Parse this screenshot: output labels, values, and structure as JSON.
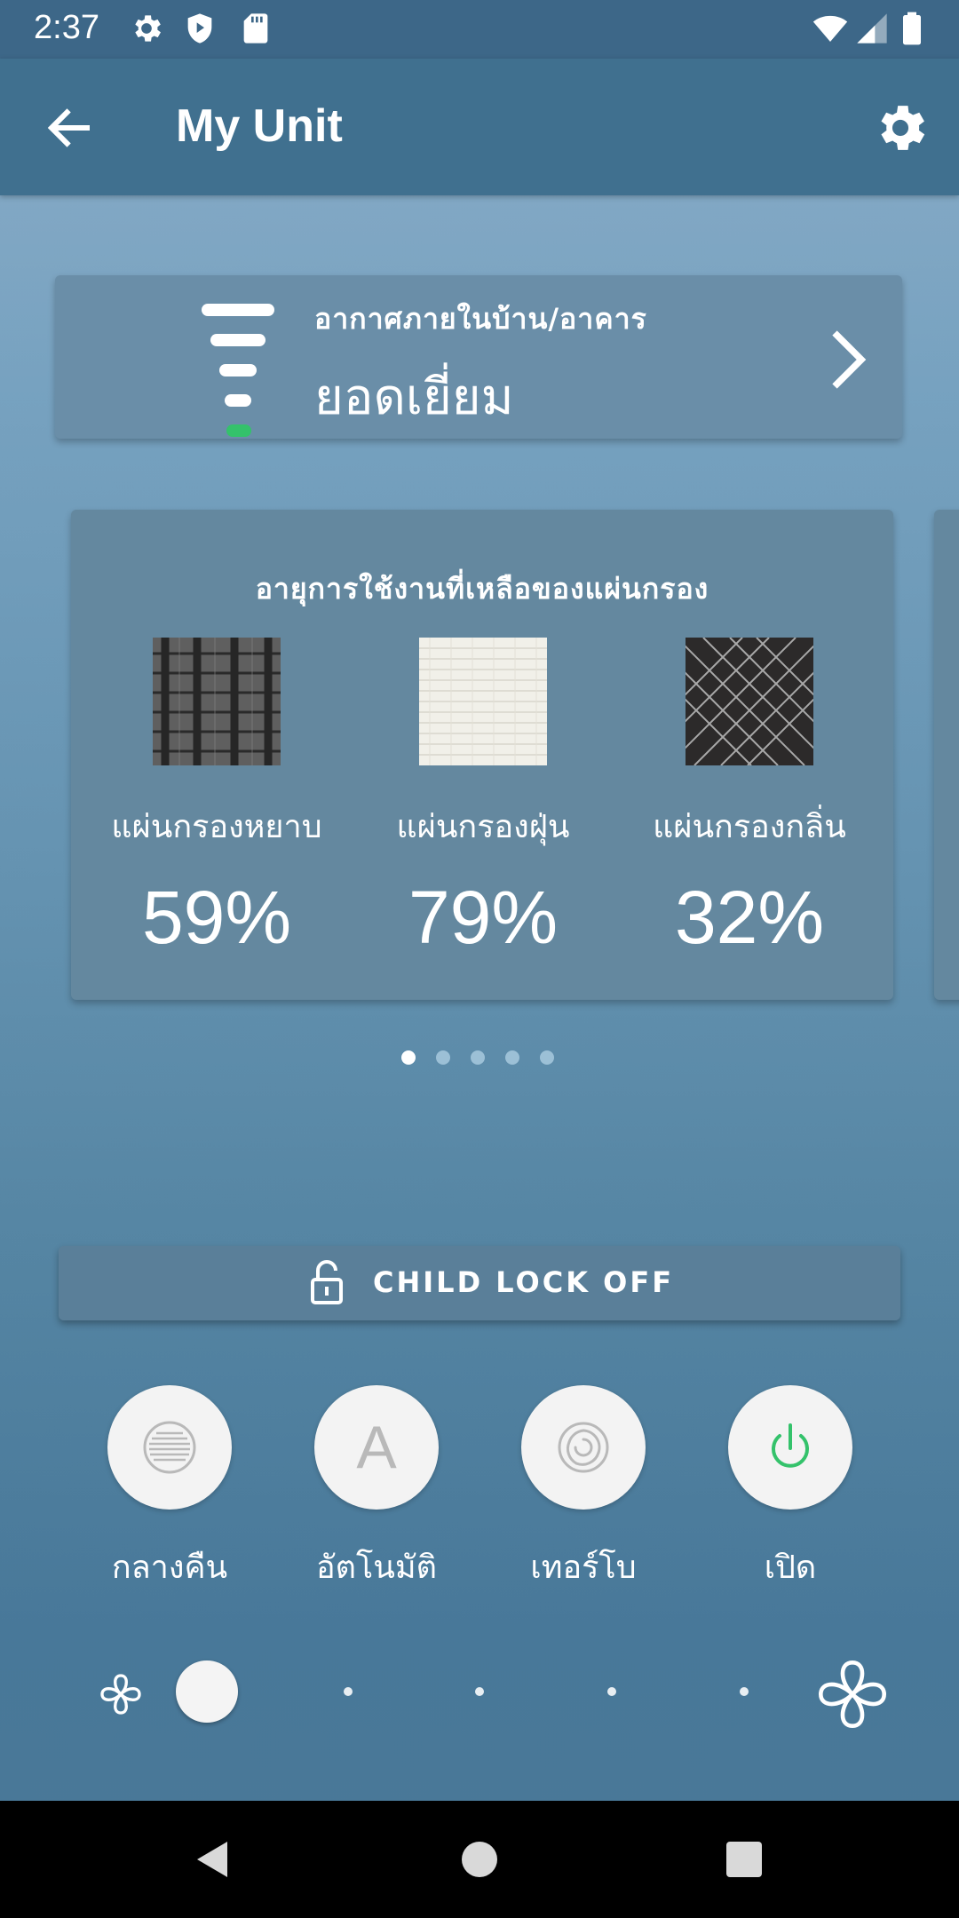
{
  "status_bar": {
    "time": "2:37",
    "icons": [
      "gear-icon",
      "shield-play-icon",
      "sd-card-icon",
      "wifi-icon",
      "signal-icon",
      "battery-icon"
    ]
  },
  "app_bar": {
    "title": "My Unit",
    "back_icon": "arrow-left-icon",
    "settings_icon": "gear-icon"
  },
  "air_quality": {
    "label": "อากาศภายในบ้าน/อาคาร",
    "value": "ยอดเยี่ยม",
    "level_indicator_color": "#34c26b"
  },
  "filters": {
    "heading": "อายุการใช้งานที่เหลือของแผ่นกรอง",
    "items": [
      {
        "name": "แผ่นกรองหยาบ",
        "percent": "59%"
      },
      {
        "name": "แผ่นกรองฝุ่น",
        "percent": "79%"
      },
      {
        "name": "แผ่นกรองกลิ่น",
        "percent": "32%"
      }
    ]
  },
  "pager": {
    "count": 5,
    "active": 0
  },
  "child_lock": {
    "label": "CHILD LOCK OFF"
  },
  "modes": [
    {
      "label": "กลางคืน",
      "icon": "night-mode-icon"
    },
    {
      "label": "อัตโนมัติ",
      "icon": "auto-a-icon"
    },
    {
      "label": "เทอร์โบ",
      "icon": "turbo-swirl-icon"
    },
    {
      "label": "เปิด",
      "icon": "power-icon"
    }
  ],
  "fan_speed": {
    "level": 1,
    "levels": 6
  },
  "colors": {
    "power_green": "#34c26b",
    "status_bar": "#3d6788",
    "app_bar": "#40708f"
  }
}
